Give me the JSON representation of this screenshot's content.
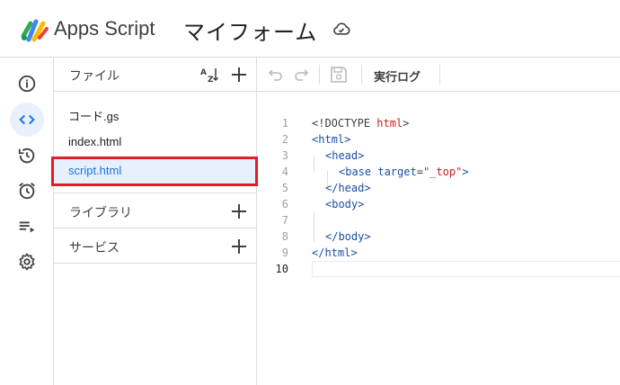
{
  "header": {
    "app_name": "Apps Script",
    "project_title": "マイフォーム"
  },
  "rail": {
    "items": [
      {
        "name": "overview",
        "icon": "info-icon"
      },
      {
        "name": "editor",
        "icon": "code-icon",
        "active": true
      },
      {
        "name": "history",
        "icon": "history-icon"
      },
      {
        "name": "triggers",
        "icon": "alarm-icon"
      },
      {
        "name": "executions",
        "icon": "executions-list-icon"
      },
      {
        "name": "settings",
        "icon": "gear-icon"
      }
    ]
  },
  "files": {
    "title": "ファイル",
    "items": [
      {
        "label": "コード.gs"
      },
      {
        "label": "index.html"
      },
      {
        "label": "script.html",
        "selected": true
      }
    ],
    "sections": [
      {
        "label": "ライブラリ"
      },
      {
        "label": "サービス"
      }
    ]
  },
  "toolbar": {
    "exec_log_label": "実行ログ"
  },
  "editor": {
    "lines": [
      {
        "n": "1"
      },
      {
        "n": "2"
      },
      {
        "n": "3"
      },
      {
        "n": "4"
      },
      {
        "n": "5"
      },
      {
        "n": "6"
      },
      {
        "n": "7"
      },
      {
        "n": "8"
      },
      {
        "n": "9"
      },
      {
        "n": "10"
      }
    ],
    "tokens": {
      "l1a": "<!DOCTYPE ",
      "l1b": "html",
      "l1c": ">",
      "l2": "<html>",
      "l3": "<head>",
      "l4a": "<base ",
      "l4b": "target",
      "l4c": "=",
      "l4d": "\"_top\"",
      "l4e": ">",
      "l5": "</head>",
      "l6": "<body>",
      "l8": "</body>",
      "l9": "</html>"
    }
  },
  "colors": {
    "accent": "#1a73e8",
    "selected_bg": "#e8f0fe",
    "highlight_border": "#e51c23"
  }
}
